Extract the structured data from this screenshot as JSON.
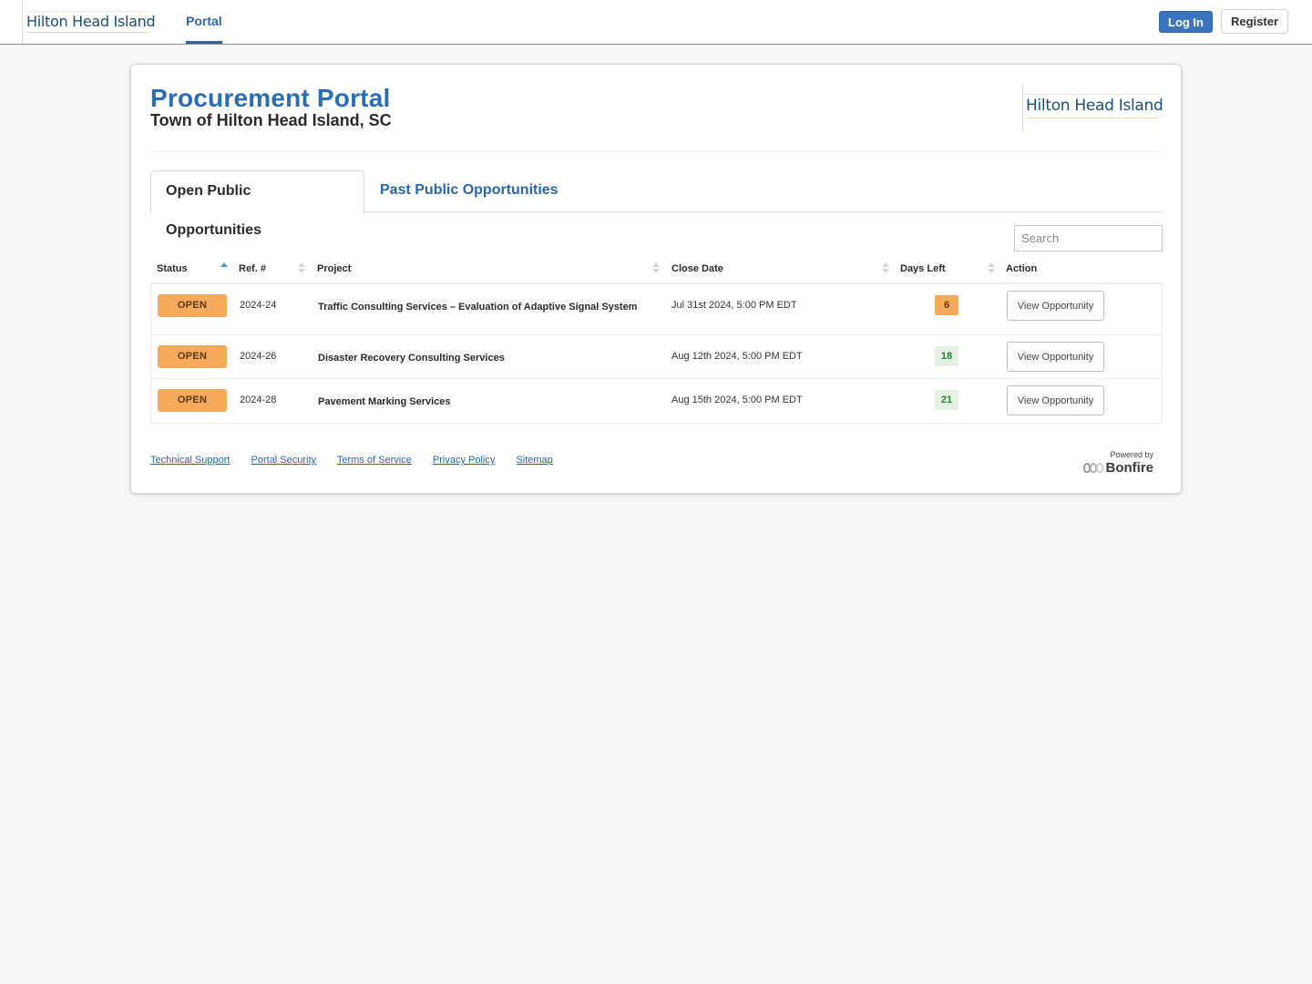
{
  "topbar": {
    "logo_text": "Hilton Head Island",
    "nav_portal": "Portal",
    "login_label": "Log In",
    "register_label": "Register"
  },
  "header": {
    "title": "Procurement Portal",
    "subtitle": "Town of Hilton Head Island, SC",
    "logo_text": "Hilton Head Island"
  },
  "tabs": [
    {
      "label": "Open Public Opportunities",
      "active": true
    },
    {
      "label": "Past Public Opportunities",
      "active": false
    }
  ],
  "search": {
    "placeholder": "Search",
    "value": ""
  },
  "table": {
    "columns": [
      {
        "label": "Status",
        "sort": "asc"
      },
      {
        "label": "Ref. #",
        "sort": "none"
      },
      {
        "label": "Project",
        "sort": "none"
      },
      {
        "label": "Close Date",
        "sort": "none"
      },
      {
        "label": "Days Left",
        "sort": "none"
      },
      {
        "label": "Action",
        "sort": null
      }
    ],
    "rows": [
      {
        "status": "OPEN",
        "ref": "2024-24",
        "project": "Traffic Consulting Services – Evaluation of Adaptive Signal System",
        "close_date": "Jul 31st 2024, 5:00 PM EDT",
        "days_left": "6",
        "action": "View Opportunity"
      },
      {
        "status": "OPEN",
        "ref": "2024-26",
        "project": "Disaster Recovery Consulting Services",
        "close_date": "Aug 12th 2024, 5:00 PM EDT",
        "days_left": "18",
        "action": "View Opportunity"
      },
      {
        "status": "OPEN",
        "ref": "2024-28",
        "project": "Pavement Marking Services",
        "close_date": "Aug 15th 2024, 5:00 PM EDT",
        "days_left": "21",
        "action": "View Opportunity"
      }
    ]
  },
  "footer": {
    "links": [
      "Technical Support",
      "Portal Security",
      "Terms of Service",
      "Privacy Policy",
      "Sitemap"
    ],
    "powered_by": "Powered by",
    "brand": "Bonfire"
  },
  "colors": {
    "accent": "#2a67a8",
    "title_blue": "#2a6db3",
    "login_button": "#3d74c0",
    "status_open": "#f7a95a",
    "days_ok_bg": "#e5f1e3",
    "days_ok_text": "#2d7d3a"
  }
}
